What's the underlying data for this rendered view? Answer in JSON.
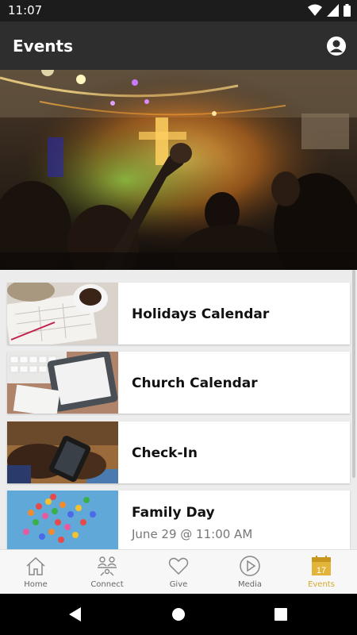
{
  "status_bar": {
    "time": "11:07"
  },
  "app_bar": {
    "title": "Events"
  },
  "events": [
    {
      "title": "Holidays Calendar",
      "subtitle": ""
    },
    {
      "title": "Church Calendar",
      "subtitle": ""
    },
    {
      "title": "Check-In",
      "subtitle": ""
    },
    {
      "title": "Family Day",
      "subtitle": "June 29 @ 11:00 AM"
    }
  ],
  "bottom_nav": [
    {
      "label": "Home",
      "icon": "home-icon",
      "active": false
    },
    {
      "label": "Connect",
      "icon": "connect-icon",
      "active": false
    },
    {
      "label": "Give",
      "icon": "heart-icon",
      "active": false
    },
    {
      "label": "Media",
      "icon": "play-icon",
      "active": false
    },
    {
      "label": "Events",
      "icon": "calendar-icon",
      "active": true,
      "badge": "17"
    }
  ],
  "colors": {
    "accent": "#d4a72c",
    "app_bar": "#2e2e2e",
    "status_bar": "#1c1c1c"
  }
}
